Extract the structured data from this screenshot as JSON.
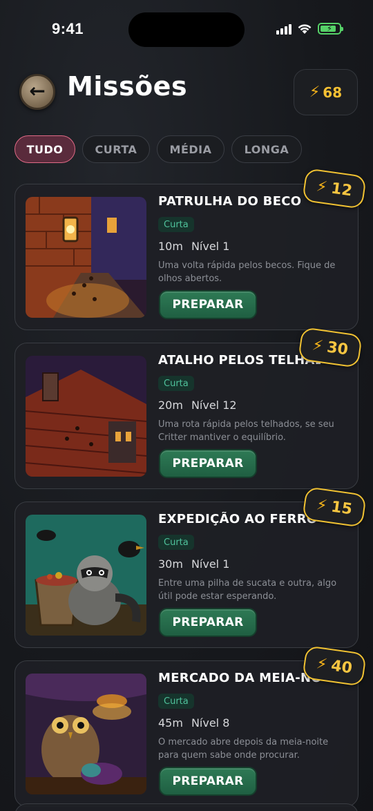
{
  "status_bar": {
    "time": "9:41"
  },
  "header": {
    "title": "Missões",
    "energy": "68"
  },
  "filters": [
    {
      "label": "TUDO",
      "active": true
    },
    {
      "label": "CURTA",
      "active": false
    },
    {
      "label": "MÉDIA",
      "active": false
    },
    {
      "label": "LONGA",
      "active": false
    }
  ],
  "missions": [
    {
      "title": "PATRULHA DO BECO",
      "tag": "Curta",
      "duration": "10m",
      "level": "Nível 1",
      "description": "Uma volta rápida pelos becos. Fique de olhos abertos.",
      "reward": "12",
      "button": "PREPARAR",
      "image": "alley-lantern-image"
    },
    {
      "title": "ATALHO PELOS TELHADOS",
      "tag": "Curta",
      "duration": "20m",
      "level": "Nível 12",
      "description": "Uma rota rápida pelos telhados, se seu Critter mantiver o equilíbrio.",
      "reward": "30",
      "button": "PREPARAR",
      "image": "rooftops-image"
    },
    {
      "title": "EXPEDIÇÃO AO FERRO-VELHO",
      "tag": "Curta",
      "duration": "30m",
      "level": "Nível 1",
      "description": "Entre uma pilha de sucata e outra, algo útil pode estar esperando.",
      "reward": "15",
      "button": "PREPARAR",
      "image": "raccoon-junkyard-image"
    },
    {
      "title": "MERCADO DA MEIA-NOITE",
      "tag": "Curta",
      "duration": "45m",
      "level": "Nível 8",
      "description": "O mercado abre depois da meia-noite para quem sabe onde procurar.",
      "reward": "40",
      "button": "PREPARAR",
      "image": "owl-market-image"
    }
  ],
  "colors": {
    "accent_energy": "#f5c033",
    "tag_green": "#4fc29b",
    "active_chip": "#e06a86",
    "prepare_button": "#2e7a55"
  }
}
